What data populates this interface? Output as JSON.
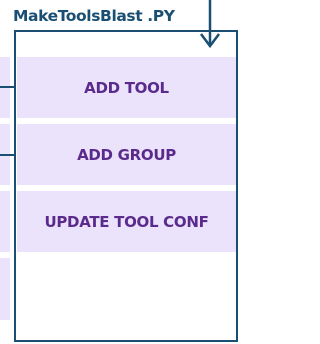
{
  "diagram": {
    "title": "MakeToolsBlast .PY",
    "boxes": [
      {
        "label": "ADD TOOL"
      },
      {
        "label": "ADD GROUP"
      },
      {
        "label": "UPDATE TOOL CONF"
      },
      {
        "label": ""
      }
    ],
    "colors": {
      "frame": "#1a4f73",
      "box_fill": "#ebe3fb",
      "box_text": "#5a2a8c"
    }
  }
}
